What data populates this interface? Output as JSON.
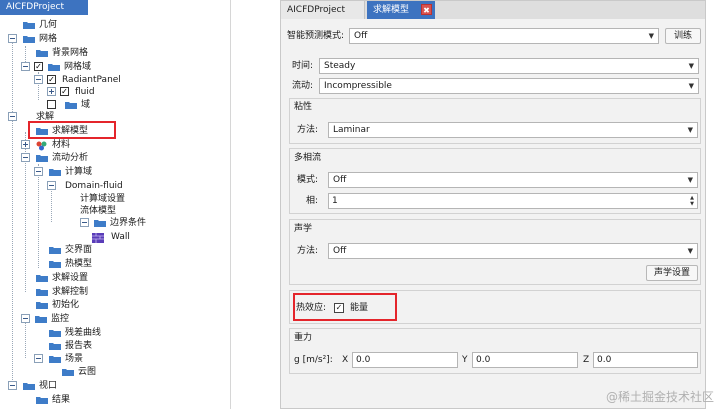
{
  "left_panel": {
    "title": "AICFDProject",
    "tree": [
      {
        "label": "几何"
      },
      {
        "label": "网格"
      },
      {
        "label": "背景网格"
      },
      {
        "label": "网格域"
      },
      {
        "label": "RadiantPanel"
      },
      {
        "label": "fluid"
      },
      {
        "label": "域"
      },
      {
        "label": "求解"
      },
      {
        "label": "求解模型"
      },
      {
        "label": "材料"
      },
      {
        "label": "流动分析"
      },
      {
        "label": "计算域"
      },
      {
        "label": "Domain-fluid"
      },
      {
        "label": "计算域设置"
      },
      {
        "label": "流体模型"
      },
      {
        "label": "边界条件"
      },
      {
        "label": "Wall"
      },
      {
        "label": "交界面"
      },
      {
        "label": "热模型"
      },
      {
        "label": "求解设置"
      },
      {
        "label": "求解控制"
      },
      {
        "label": "初始化"
      },
      {
        "label": "监控"
      },
      {
        "label": "残差曲线"
      },
      {
        "label": "报告表"
      },
      {
        "label": "场景"
      },
      {
        "label": "云图"
      },
      {
        "label": "视口"
      },
      {
        "label": "结果"
      }
    ]
  },
  "right_panel": {
    "tabs": [
      {
        "label": "AICFDProject"
      },
      {
        "label": "求解模型"
      }
    ],
    "close_glyph": "✖",
    "smart_predict": {
      "label": "智能预测模式:",
      "value": "Off",
      "train_button": "训练"
    },
    "time": {
      "label": "时间:",
      "value": "Steady"
    },
    "flow": {
      "label": "流动:",
      "value": "Incompressible"
    },
    "viscosity": {
      "title": "粘性",
      "method_label": "方法:",
      "method_value": "Laminar"
    },
    "multiphase": {
      "title": "多相流",
      "mode_label": "模式:",
      "mode_value": "Off",
      "phase_label": "相:",
      "phase_value": "1"
    },
    "acoustics": {
      "title": "声学",
      "method_label": "方法:",
      "method_value": "Off",
      "settings_button": "声学设置"
    },
    "thermal": {
      "label": "热效应:",
      "checkbox_label": "能量",
      "checked": true
    },
    "gravity": {
      "title": "重力",
      "g_label": "g [m/s²]:",
      "x_label": "X",
      "x_value": "0.0",
      "y_label": "Y",
      "y_value": "0.0",
      "z_label": "Z",
      "z_value": "0.0"
    }
  },
  "watermark": "@稀土掘金技术社区",
  "colors": {
    "accent": "#3d73c0",
    "highlight": "#e4252b"
  }
}
